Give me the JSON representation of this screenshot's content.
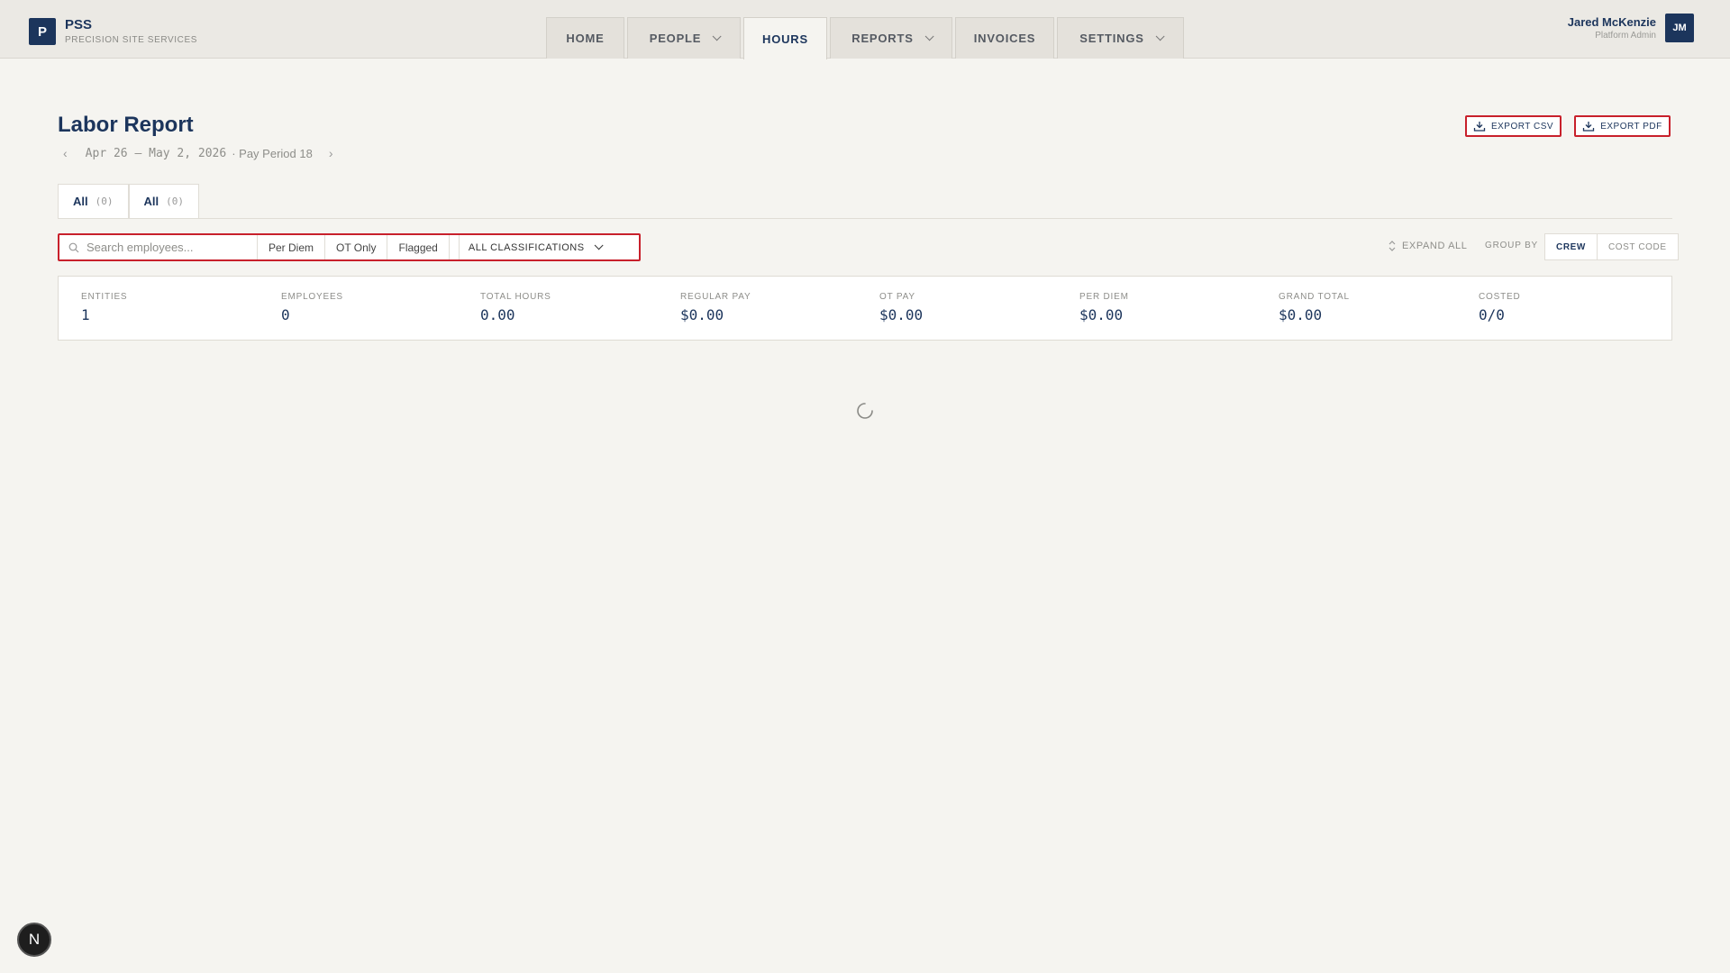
{
  "brand": {
    "logo_letter": "P",
    "name": "PSS",
    "subtitle": "PRECISION SITE SERVICES"
  },
  "nav": {
    "tabs": [
      {
        "label": "HOME",
        "dropdown": false,
        "active": false
      },
      {
        "label": "PEOPLE",
        "dropdown": true,
        "active": false
      },
      {
        "label": "HOURS",
        "dropdown": false,
        "active": true
      },
      {
        "label": "REPORTS",
        "dropdown": true,
        "active": false
      },
      {
        "label": "INVOICES",
        "dropdown": false,
        "active": false
      },
      {
        "label": "SETTINGS",
        "dropdown": true,
        "active": false
      }
    ]
  },
  "user": {
    "name": "Jared McKenzie",
    "role": "Platform Admin",
    "initials": "JM"
  },
  "header": {
    "title": "Labor Report",
    "prev_arrow": "‹",
    "next_arrow": "›",
    "date_range": "Apr 26 – May 2, 2026",
    "pay_period": "· Pay Period 18",
    "export_csv": "EXPORT CSV",
    "export_pdf": "EXPORT PDF"
  },
  "subtabs": [
    {
      "label": "All",
      "count": "(0)"
    },
    {
      "label": "All",
      "count": "(0)"
    }
  ],
  "filters": {
    "search_placeholder": "Search employees...",
    "chips": [
      "Per Diem",
      "OT Only",
      "Flagged"
    ],
    "classification": "ALL CLASSIFICATIONS"
  },
  "toolbar": {
    "expand_all": "EXPAND ALL",
    "group_by_label": "GROUP BY",
    "group_by_options": [
      "CREW",
      "COST CODE"
    ],
    "group_by_selected": "CREW"
  },
  "summary": [
    {
      "label": "ENTITIES",
      "value": "1"
    },
    {
      "label": "EMPLOYEES",
      "value": "0"
    },
    {
      "label": "TOTAL HOURS",
      "value": "0.00"
    },
    {
      "label": "REGULAR PAY",
      "value": "$0.00"
    },
    {
      "label": "OT PAY",
      "value": "$0.00"
    },
    {
      "label": "PER DIEM",
      "value": "$0.00"
    },
    {
      "label": "GRAND TOTAL",
      "value": "$0.00"
    },
    {
      "label": "COSTED",
      "value": "0/0"
    }
  ],
  "dev_badge": "N",
  "colors": {
    "brand": "#1c355c",
    "highlight": "#c8202b",
    "background": "#f5f4f0"
  }
}
